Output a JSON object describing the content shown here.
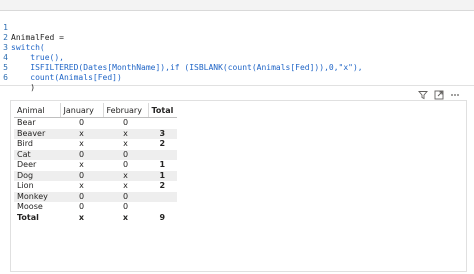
{
  "code_editor": {
    "lines": [
      {
        "num": "1",
        "text": "AnimalFed ="
      },
      {
        "num": "2",
        "text": "switch("
      },
      {
        "num": "3",
        "text": "    true(),"
      },
      {
        "num": "4",
        "text": "    ISFILTERED(Dates[MonthName]),if (ISBLANK(count(Animals[Fed])),0,\"x\"),"
      },
      {
        "num": "5",
        "text": "    count(Animals[Fed])"
      },
      {
        "num": "6",
        "text": "    )"
      }
    ]
  },
  "visual_header": {
    "icons": [
      "filter-icon",
      "focus-mode-icon",
      "more-options-icon"
    ]
  },
  "matrix": {
    "headers": [
      "Animal",
      "January",
      "February",
      "Total"
    ],
    "rows": [
      {
        "animal": "Bear",
        "january": "0",
        "february": "0",
        "total": ""
      },
      {
        "animal": "Beaver",
        "january": "x",
        "february": "x",
        "total": "3"
      },
      {
        "animal": "Bird",
        "january": "x",
        "february": "x",
        "total": "2"
      },
      {
        "animal": "Cat",
        "january": "0",
        "february": "0",
        "total": ""
      },
      {
        "animal": "Deer",
        "january": "x",
        "february": "0",
        "total": "1"
      },
      {
        "animal": "Dog",
        "january": "0",
        "february": "x",
        "total": "1"
      },
      {
        "animal": "Lion",
        "january": "x",
        "february": "x",
        "total": "2"
      },
      {
        "animal": "Monkey",
        "january": "0",
        "february": "0",
        "total": ""
      },
      {
        "animal": "Moose",
        "january": "0",
        "february": "0",
        "total": ""
      }
    ],
    "total_row": {
      "animal": "Total",
      "january": "x",
      "february": "x",
      "total": "9"
    }
  }
}
